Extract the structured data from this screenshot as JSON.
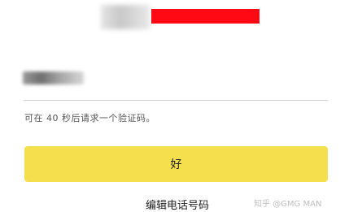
{
  "verification": {
    "code_value": "",
    "countdown_seconds": 40,
    "hint_text": "可在 40 秒后请求一个验证码。",
    "confirm_label": "好",
    "edit_phone_label": "编辑电话号码",
    "watermark_text": "知乎 @GMG MAN",
    "accent_color": "#f5df4d",
    "redaction_color": "#ff0a14"
  }
}
